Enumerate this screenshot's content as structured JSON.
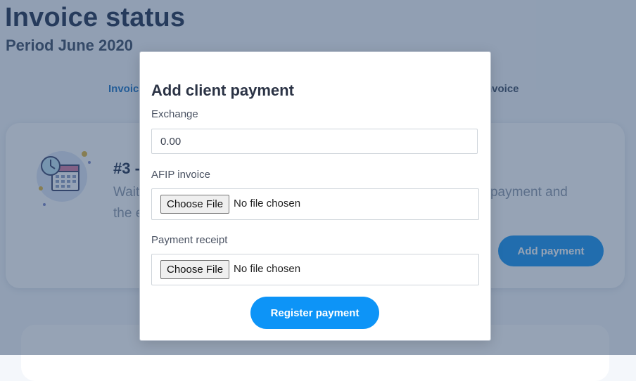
{
  "page": {
    "title": "Invoice status",
    "subtitle": "Period June 2020"
  },
  "tabs": [
    {
      "label": "Invoic"
    },
    {
      "label": "nvoice"
    }
  ],
  "card": {
    "step_title": "#3 -",
    "description_line1": "Wait",
    "description_line1_end": "the payment and",
    "description_line2": "the e",
    "action_label": "Add payment",
    "icon": "calendar-clock-icon"
  },
  "modal": {
    "title": "Add client payment",
    "exchange": {
      "label": "Exchange",
      "value": "0.00"
    },
    "afip_invoice": {
      "label": "AFIP invoice",
      "button_label": "Choose File",
      "status": "No file chosen"
    },
    "payment_receipt": {
      "label": "Payment receipt",
      "button_label": "Choose File",
      "status": "No file chosen"
    },
    "submit_label": "Register payment"
  },
  "colors": {
    "accent": "#0d94f7",
    "title": "#1e2f4d",
    "overlay": "rgba(45,72,108,0.50)"
  }
}
